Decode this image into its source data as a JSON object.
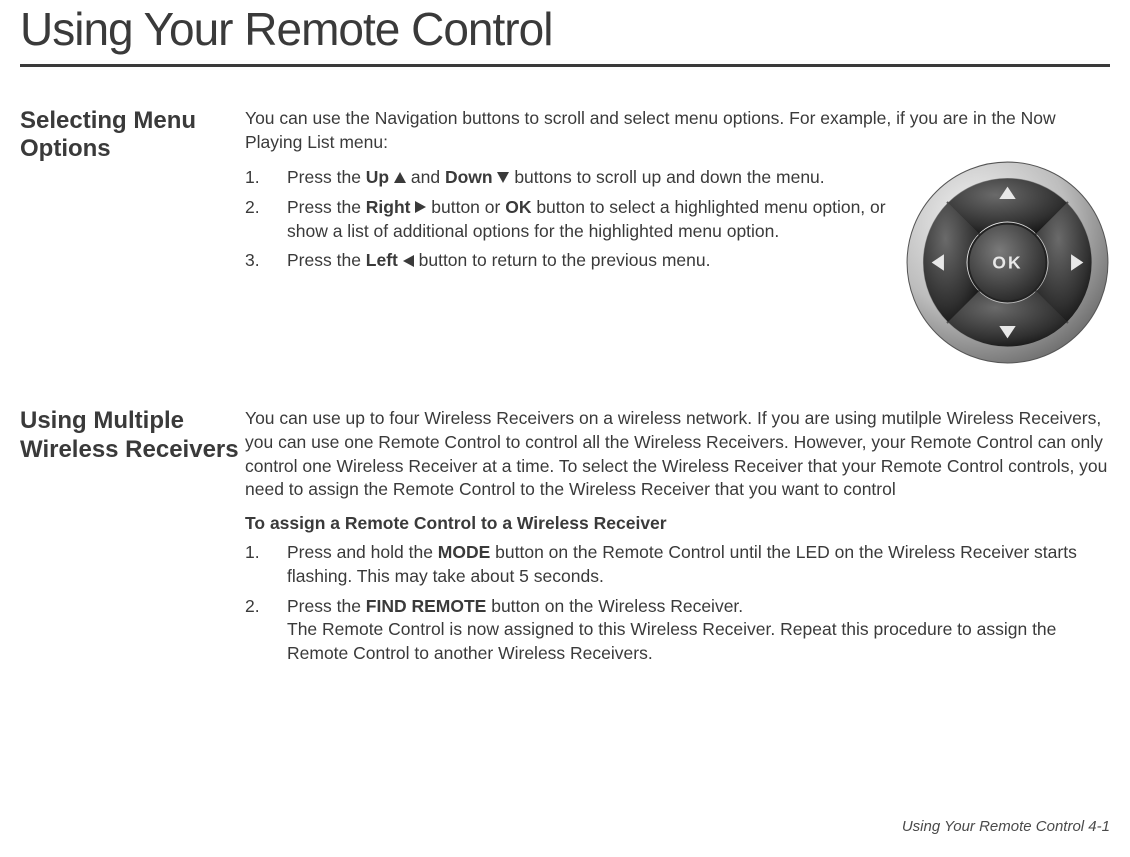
{
  "page_title": "Using Your Remote Control",
  "section1": {
    "heading": "Selecting Menu Options",
    "intro": "You can use the Navigation buttons to scroll and select menu options. For example, if you are in the Now Playing List menu:",
    "step1_num": "1.",
    "step1_a": "Press the ",
    "step1_up": "Up",
    "step1_and": " and ",
    "step1_down": "Down",
    "step1_b": " buttons to scroll up and down the menu.",
    "step2_num": "2.",
    "step2_a": "Press the ",
    "step2_right": "Right",
    "step2_b": " button or ",
    "step2_ok": "OK",
    "step2_c": " button to select a highlighted menu option, or show a list of additional options for the highlighted menu option.",
    "step3_num": "3.",
    "step3_a": "Press the ",
    "step3_left": "Left",
    "step3_b": " button to return to the previous menu."
  },
  "section2": {
    "heading": "Using Multiple Wireless Receivers",
    "intro": "You can use up to four Wireless Receivers on a wireless network. If you are using mutilple Wireless Receivers, you can use one Remote Control to control all the Wireless Receivers. However, your Remote Control can only control one Wireless Receiver at a time. To select the Wireless Receiver that your Remote Control controls, you need to assign the Remote Control to the Wireless Receiver that you want to control",
    "subhead": "To assign a Remote Control to a Wireless Receiver",
    "step1_num": "1.",
    "step1_a": "Press and hold the ",
    "step1_mode": "MODE",
    "step1_b": " button on the Remote Control until the LED on the Wireless Receiver starts flashing. This may take about 5 seconds.",
    "step2_num": "2.",
    "step2_a": "Press the ",
    "step2_find": "FIND REMOTE",
    "step2_b": " button on the Wireless Receiver.",
    "step2_c": "The Remote Control is now assigned to this Wireless Receiver. Repeat this procedure to assign the Remote Control to another Wireless Receivers."
  },
  "footer": "Using Your Remote Control  4-1",
  "remote": {
    "ok_label": "OK"
  }
}
